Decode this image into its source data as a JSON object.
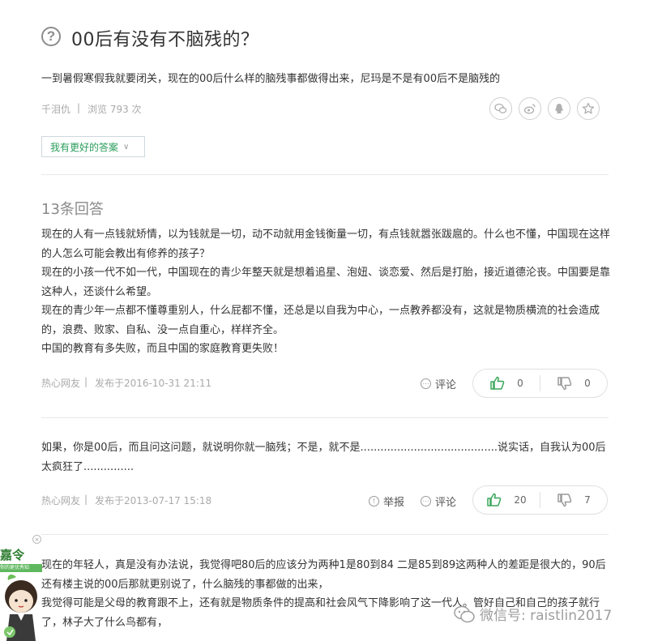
{
  "question": {
    "title": "00后有没有不脑残的？",
    "description": "一到暑假寒假我就要闭关，现在的00后什么样的脑残事都做得出来，尼玛是不是有00后不是脑残的",
    "author": "千泪仇",
    "views": "浏览 793 次",
    "better_answer_button": "我有更好的答案",
    "share_icons": [
      "wechat-icon",
      "weibo-icon",
      "qq-icon",
      "star-icon"
    ]
  },
  "answers_header": "13条回答",
  "answers": [
    {
      "paragraphs": [
        "现在的人有一点钱就矫情，以为钱就是一切，动不动就用金钱衡量一切，有点钱就嚣张跋扈的。什么也不懂，中国现在这样的人怎么可能会教出有修养的孩子？",
        "现在的小孩一代不如一代，中国现在的青少年整天就是想着追星、泡妞、谈恋爱、然后是打胎，接近道德沦丧。中国要是靠这种人，还谈什么希望。",
        "现在的青少年一点都不懂尊重别人，什么屁都不懂，还总是以自我为中心，一点教养都没有，这就是物质横流的社会造成的，浪费、败家、自私、没一点自重心，样样齐全。",
        "中国的教育有多失败，而且中国的家庭教育更失败！"
      ],
      "author": "热心网友",
      "published": "发布于2016-10-31 21:11",
      "report": "",
      "comment": "评论",
      "likes": "0",
      "dislikes": "0"
    },
    {
      "paragraphs": [
        "如果，你是00后，而且问这问题，就说明你就一脑残；不是，就不是.........................................说实话，自我认为00后太疯狂了..............."
      ],
      "author": "热心网友",
      "published": "发布于2013-07-17 15:18",
      "report": "举报",
      "comment": "评论",
      "likes": "20",
      "dislikes": "7"
    },
    {
      "paragraphs": [
        "现在的年轻人，真是没有办法说，我觉得吧80后的应该分为两种1是80到84 二是85到89这两种人的差距是很大的，90后还有楼主说的00后那就更别说了，什么脑残的事都做的出来，",
        "我觉得可能是父母的教育跟不上，还有就是物质条件的提高和社会风气下降影响了这一代人。管好自己和自己的孩子就行了，林子大了什么鸟都有，"
      ]
    }
  ],
  "mascot": {
    "name": "嘉令",
    "tagline": "你的更优秀知"
  },
  "watermark": "微信号: raistlin2017",
  "colors": {
    "accent_green": "#2a9d5c",
    "thumb_green": "#3aa65a",
    "muted_gray": "#aaaaaa"
  }
}
